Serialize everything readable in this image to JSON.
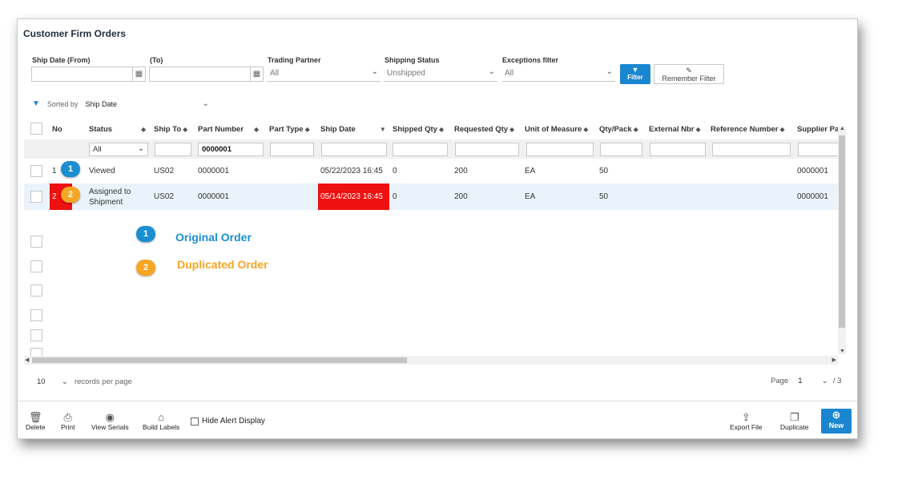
{
  "window": {
    "title": "Customer Firm Orders"
  },
  "filters": {
    "ship_date_from_label": "Ship Date (From)",
    "ship_date_to_label": "(To)",
    "trading_partner_label": "Trading Partner",
    "trading_partner_value": "All",
    "shipping_status_label": "Shipping Status",
    "shipping_status_value": "Unshipped",
    "exceptions_label": "Exceptions filter",
    "exceptions_value": "All",
    "filter_button": "Filter",
    "remember_button": "Remember Filter"
  },
  "sort": {
    "label": "Sorted by",
    "value": "Ship Date"
  },
  "table": {
    "headers": [
      "No",
      "Status",
      "Ship To",
      "Part Number",
      "Part Type",
      "Ship Date",
      "Shipped Qty",
      "Requested Qty",
      "Unit of Measure",
      "Qty/Pack",
      "External Nbr",
      "Reference Number",
      "Supplier Pa"
    ],
    "status_filter": "All",
    "part_number_filter": "0000001",
    "rows": [
      {
        "no": "1",
        "status": "Viewed",
        "ship_to": "US02",
        "part_number": "0000001",
        "ship_date": "05/22/2023 16:45",
        "shipped_qty": "0",
        "requested_qty": "200",
        "uom": "EA",
        "qty_pack": "50",
        "supplier_part": "0000001"
      },
      {
        "no": "2",
        "status": "Assigned to Shipment",
        "ship_to": "US02",
        "part_number": "0000001",
        "ship_date": "05/14/2023 16:45",
        "shipped_qty": "0",
        "requested_qty": "200",
        "uom": "EA",
        "qty_pack": "50",
        "supplier_part": "0000001"
      }
    ]
  },
  "legend": {
    "badge_1": "1",
    "text_1": "Original Order",
    "color_1": "#1a8fd1",
    "badge_2": "2",
    "text_2": "Duplicated Order",
    "color_2": "#f5a623"
  },
  "pager": {
    "per_page": "10",
    "per_page_label": "records per page",
    "page_label": "Page",
    "page_value": "1",
    "total_pages": "/ 3"
  },
  "toolbar": {
    "delete": "Delete",
    "print": "Print",
    "view_serials": "View Serials",
    "build_labels": "Build Labels",
    "hide_alert": "Hide Alert Display",
    "export_file": "Export File",
    "duplicate": "Duplicate",
    "new": "New"
  },
  "colors": {
    "accent": "#1a86d0",
    "alert_red": "#ee1111"
  }
}
